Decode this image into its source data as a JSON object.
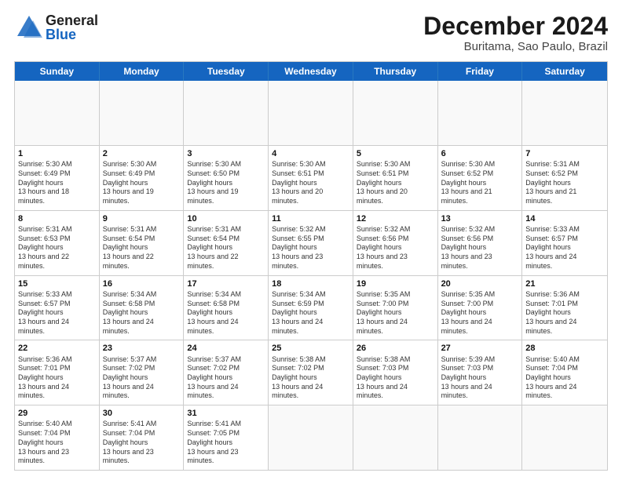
{
  "header": {
    "logo_general": "General",
    "logo_blue": "Blue",
    "title": "December 2024",
    "subtitle": "Buritama, Sao Paulo, Brazil"
  },
  "calendar": {
    "days_of_week": [
      "Sunday",
      "Monday",
      "Tuesday",
      "Wednesday",
      "Thursday",
      "Friday",
      "Saturday"
    ],
    "weeks": [
      [
        {
          "day": "",
          "empty": true
        },
        {
          "day": "",
          "empty": true
        },
        {
          "day": "",
          "empty": true
        },
        {
          "day": "",
          "empty": true
        },
        {
          "day": "",
          "empty": true
        },
        {
          "day": "",
          "empty": true
        },
        {
          "day": "",
          "empty": true
        }
      ],
      [
        {
          "num": "1",
          "rise": "5:30 AM",
          "set": "6:49 PM",
          "hours": "13 hours and 18 minutes."
        },
        {
          "num": "2",
          "rise": "5:30 AM",
          "set": "6:49 PM",
          "hours": "13 hours and 19 minutes."
        },
        {
          "num": "3",
          "rise": "5:30 AM",
          "set": "6:50 PM",
          "hours": "13 hours and 19 minutes."
        },
        {
          "num": "4",
          "rise": "5:30 AM",
          "set": "6:51 PM",
          "hours": "13 hours and 20 minutes."
        },
        {
          "num": "5",
          "rise": "5:30 AM",
          "set": "6:51 PM",
          "hours": "13 hours and 20 minutes."
        },
        {
          "num": "6",
          "rise": "5:30 AM",
          "set": "6:52 PM",
          "hours": "13 hours and 21 minutes."
        },
        {
          "num": "7",
          "rise": "5:31 AM",
          "set": "6:52 PM",
          "hours": "13 hours and 21 minutes."
        }
      ],
      [
        {
          "num": "8",
          "rise": "5:31 AM",
          "set": "6:53 PM",
          "hours": "13 hours and 22 minutes."
        },
        {
          "num": "9",
          "rise": "5:31 AM",
          "set": "6:54 PM",
          "hours": "13 hours and 22 minutes."
        },
        {
          "num": "10",
          "rise": "5:31 AM",
          "set": "6:54 PM",
          "hours": "13 hours and 22 minutes."
        },
        {
          "num": "11",
          "rise": "5:32 AM",
          "set": "6:55 PM",
          "hours": "13 hours and 23 minutes."
        },
        {
          "num": "12",
          "rise": "5:32 AM",
          "set": "6:56 PM",
          "hours": "13 hours and 23 minutes."
        },
        {
          "num": "13",
          "rise": "5:32 AM",
          "set": "6:56 PM",
          "hours": "13 hours and 23 minutes."
        },
        {
          "num": "14",
          "rise": "5:33 AM",
          "set": "6:57 PM",
          "hours": "13 hours and 24 minutes."
        }
      ],
      [
        {
          "num": "15",
          "rise": "5:33 AM",
          "set": "6:57 PM",
          "hours": "13 hours and 24 minutes."
        },
        {
          "num": "16",
          "rise": "5:34 AM",
          "set": "6:58 PM",
          "hours": "13 hours and 24 minutes."
        },
        {
          "num": "17",
          "rise": "5:34 AM",
          "set": "6:58 PM",
          "hours": "13 hours and 24 minutes."
        },
        {
          "num": "18",
          "rise": "5:34 AM",
          "set": "6:59 PM",
          "hours": "13 hours and 24 minutes."
        },
        {
          "num": "19",
          "rise": "5:35 AM",
          "set": "7:00 PM",
          "hours": "13 hours and 24 minutes."
        },
        {
          "num": "20",
          "rise": "5:35 AM",
          "set": "7:00 PM",
          "hours": "13 hours and 24 minutes."
        },
        {
          "num": "21",
          "rise": "5:36 AM",
          "set": "7:01 PM",
          "hours": "13 hours and 24 minutes."
        }
      ],
      [
        {
          "num": "22",
          "rise": "5:36 AM",
          "set": "7:01 PM",
          "hours": "13 hours and 24 minutes."
        },
        {
          "num": "23",
          "rise": "5:37 AM",
          "set": "7:02 PM",
          "hours": "13 hours and 24 minutes."
        },
        {
          "num": "24",
          "rise": "5:37 AM",
          "set": "7:02 PM",
          "hours": "13 hours and 24 minutes."
        },
        {
          "num": "25",
          "rise": "5:38 AM",
          "set": "7:02 PM",
          "hours": "13 hours and 24 minutes."
        },
        {
          "num": "26",
          "rise": "5:38 AM",
          "set": "7:03 PM",
          "hours": "13 hours and 24 minutes."
        },
        {
          "num": "27",
          "rise": "5:39 AM",
          "set": "7:03 PM",
          "hours": "13 hours and 24 minutes."
        },
        {
          "num": "28",
          "rise": "5:40 AM",
          "set": "7:04 PM",
          "hours": "13 hours and 24 minutes."
        }
      ],
      [
        {
          "num": "29",
          "rise": "5:40 AM",
          "set": "7:04 PM",
          "hours": "13 hours and 23 minutes."
        },
        {
          "num": "30",
          "rise": "5:41 AM",
          "set": "7:04 PM",
          "hours": "13 hours and 23 minutes."
        },
        {
          "num": "31",
          "rise": "5:41 AM",
          "set": "7:05 PM",
          "hours": "13 hours and 23 minutes."
        },
        {
          "num": "",
          "empty": true
        },
        {
          "num": "",
          "empty": true
        },
        {
          "num": "",
          "empty": true
        },
        {
          "num": "",
          "empty": true
        }
      ]
    ]
  }
}
